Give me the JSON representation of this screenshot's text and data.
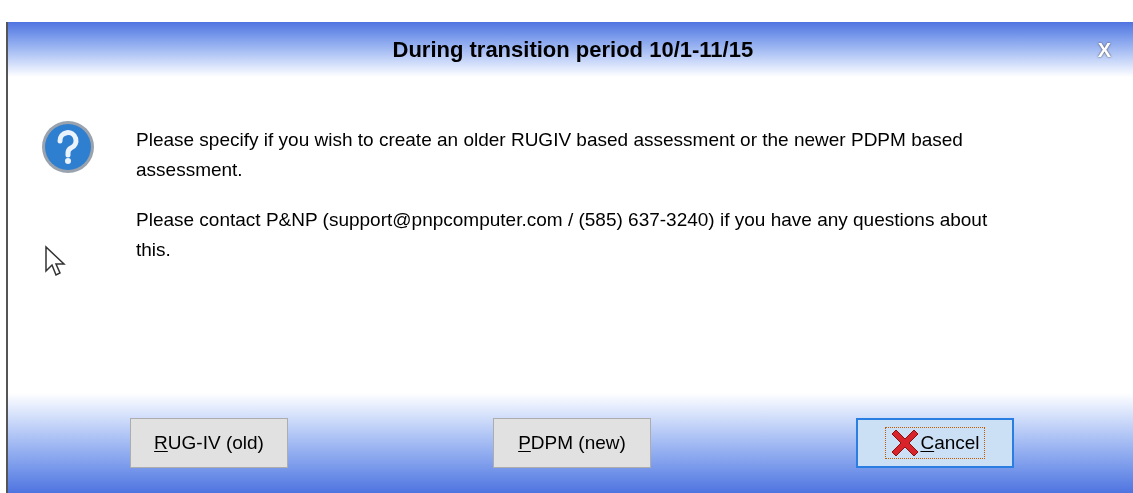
{
  "window": {
    "title": "During transition period 10/1-11/15",
    "close_glyph": "X"
  },
  "message": {
    "paragraphs": [
      "Please specify if you wish to create an older RUGIV based assessment or the newer PDPM based assessment.",
      "Please contact P&NP (support@pnpcomputer.com / (585) 637-3240) if you have any questions about this."
    ]
  },
  "buttons": [
    {
      "kind": "plain",
      "mnemonic": "R",
      "rest": "UG-IV (old)",
      "focused": false
    },
    {
      "kind": "plain",
      "mnemonic": "P",
      "rest": "DPM (new)",
      "focused": false
    },
    {
      "kind": "cancel",
      "mnemonic": "C",
      "rest": "ancel",
      "focused": true
    }
  ]
}
